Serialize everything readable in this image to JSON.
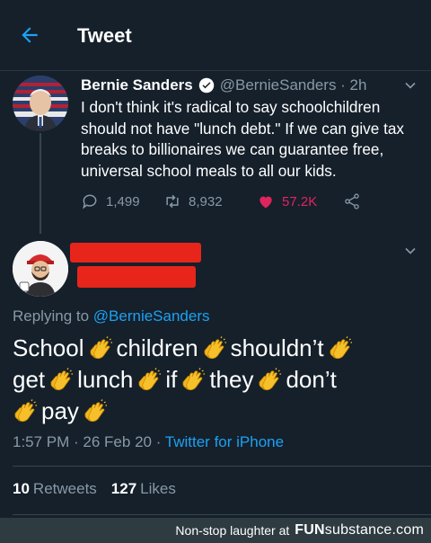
{
  "header": {
    "title": "Tweet"
  },
  "tweet1": {
    "name": "Bernie Sanders",
    "handle": "@BernieSanders · 2h",
    "text": "I don't think it's radical to say schoolchildren should not have \"lunch debt.\" If we can give tax breaks to billionaires we can guarantee free, universal school meals to all our kids.",
    "replies": "1,499",
    "retweets": "8,932",
    "likes": "57.2K"
  },
  "tweet2": {
    "replying_prefix": "Replying to ",
    "replying_handle": "@BernieSanders",
    "words": [
      "School",
      "children",
      "shouldn’t",
      "get",
      "lunch",
      "if",
      "they",
      "don’t",
      "pay"
    ],
    "time": "1:57 PM · 26 Feb 20 · ",
    "source": "Twitter for iPhone",
    "retweets_count": "10",
    "retweets_label": "Retweets",
    "likes_count": "127",
    "likes_label": "Likes"
  },
  "footer": {
    "text": "Non-stop laughter at",
    "brand_main": "FUN",
    "brand_sub": "substance",
    "brand_tld": ".com"
  },
  "colors": {
    "background": "#15202b",
    "link": "#1da1f2",
    "muted": "#8899a6",
    "like": "#e0245e",
    "redaction": "#e8251b"
  },
  "icons": [
    "back-arrow-icon",
    "verified-badge-icon",
    "chevron-down-icon",
    "reply-icon",
    "retweet-icon",
    "heart-icon",
    "share-icon",
    "clapping-hands-emoji"
  ]
}
